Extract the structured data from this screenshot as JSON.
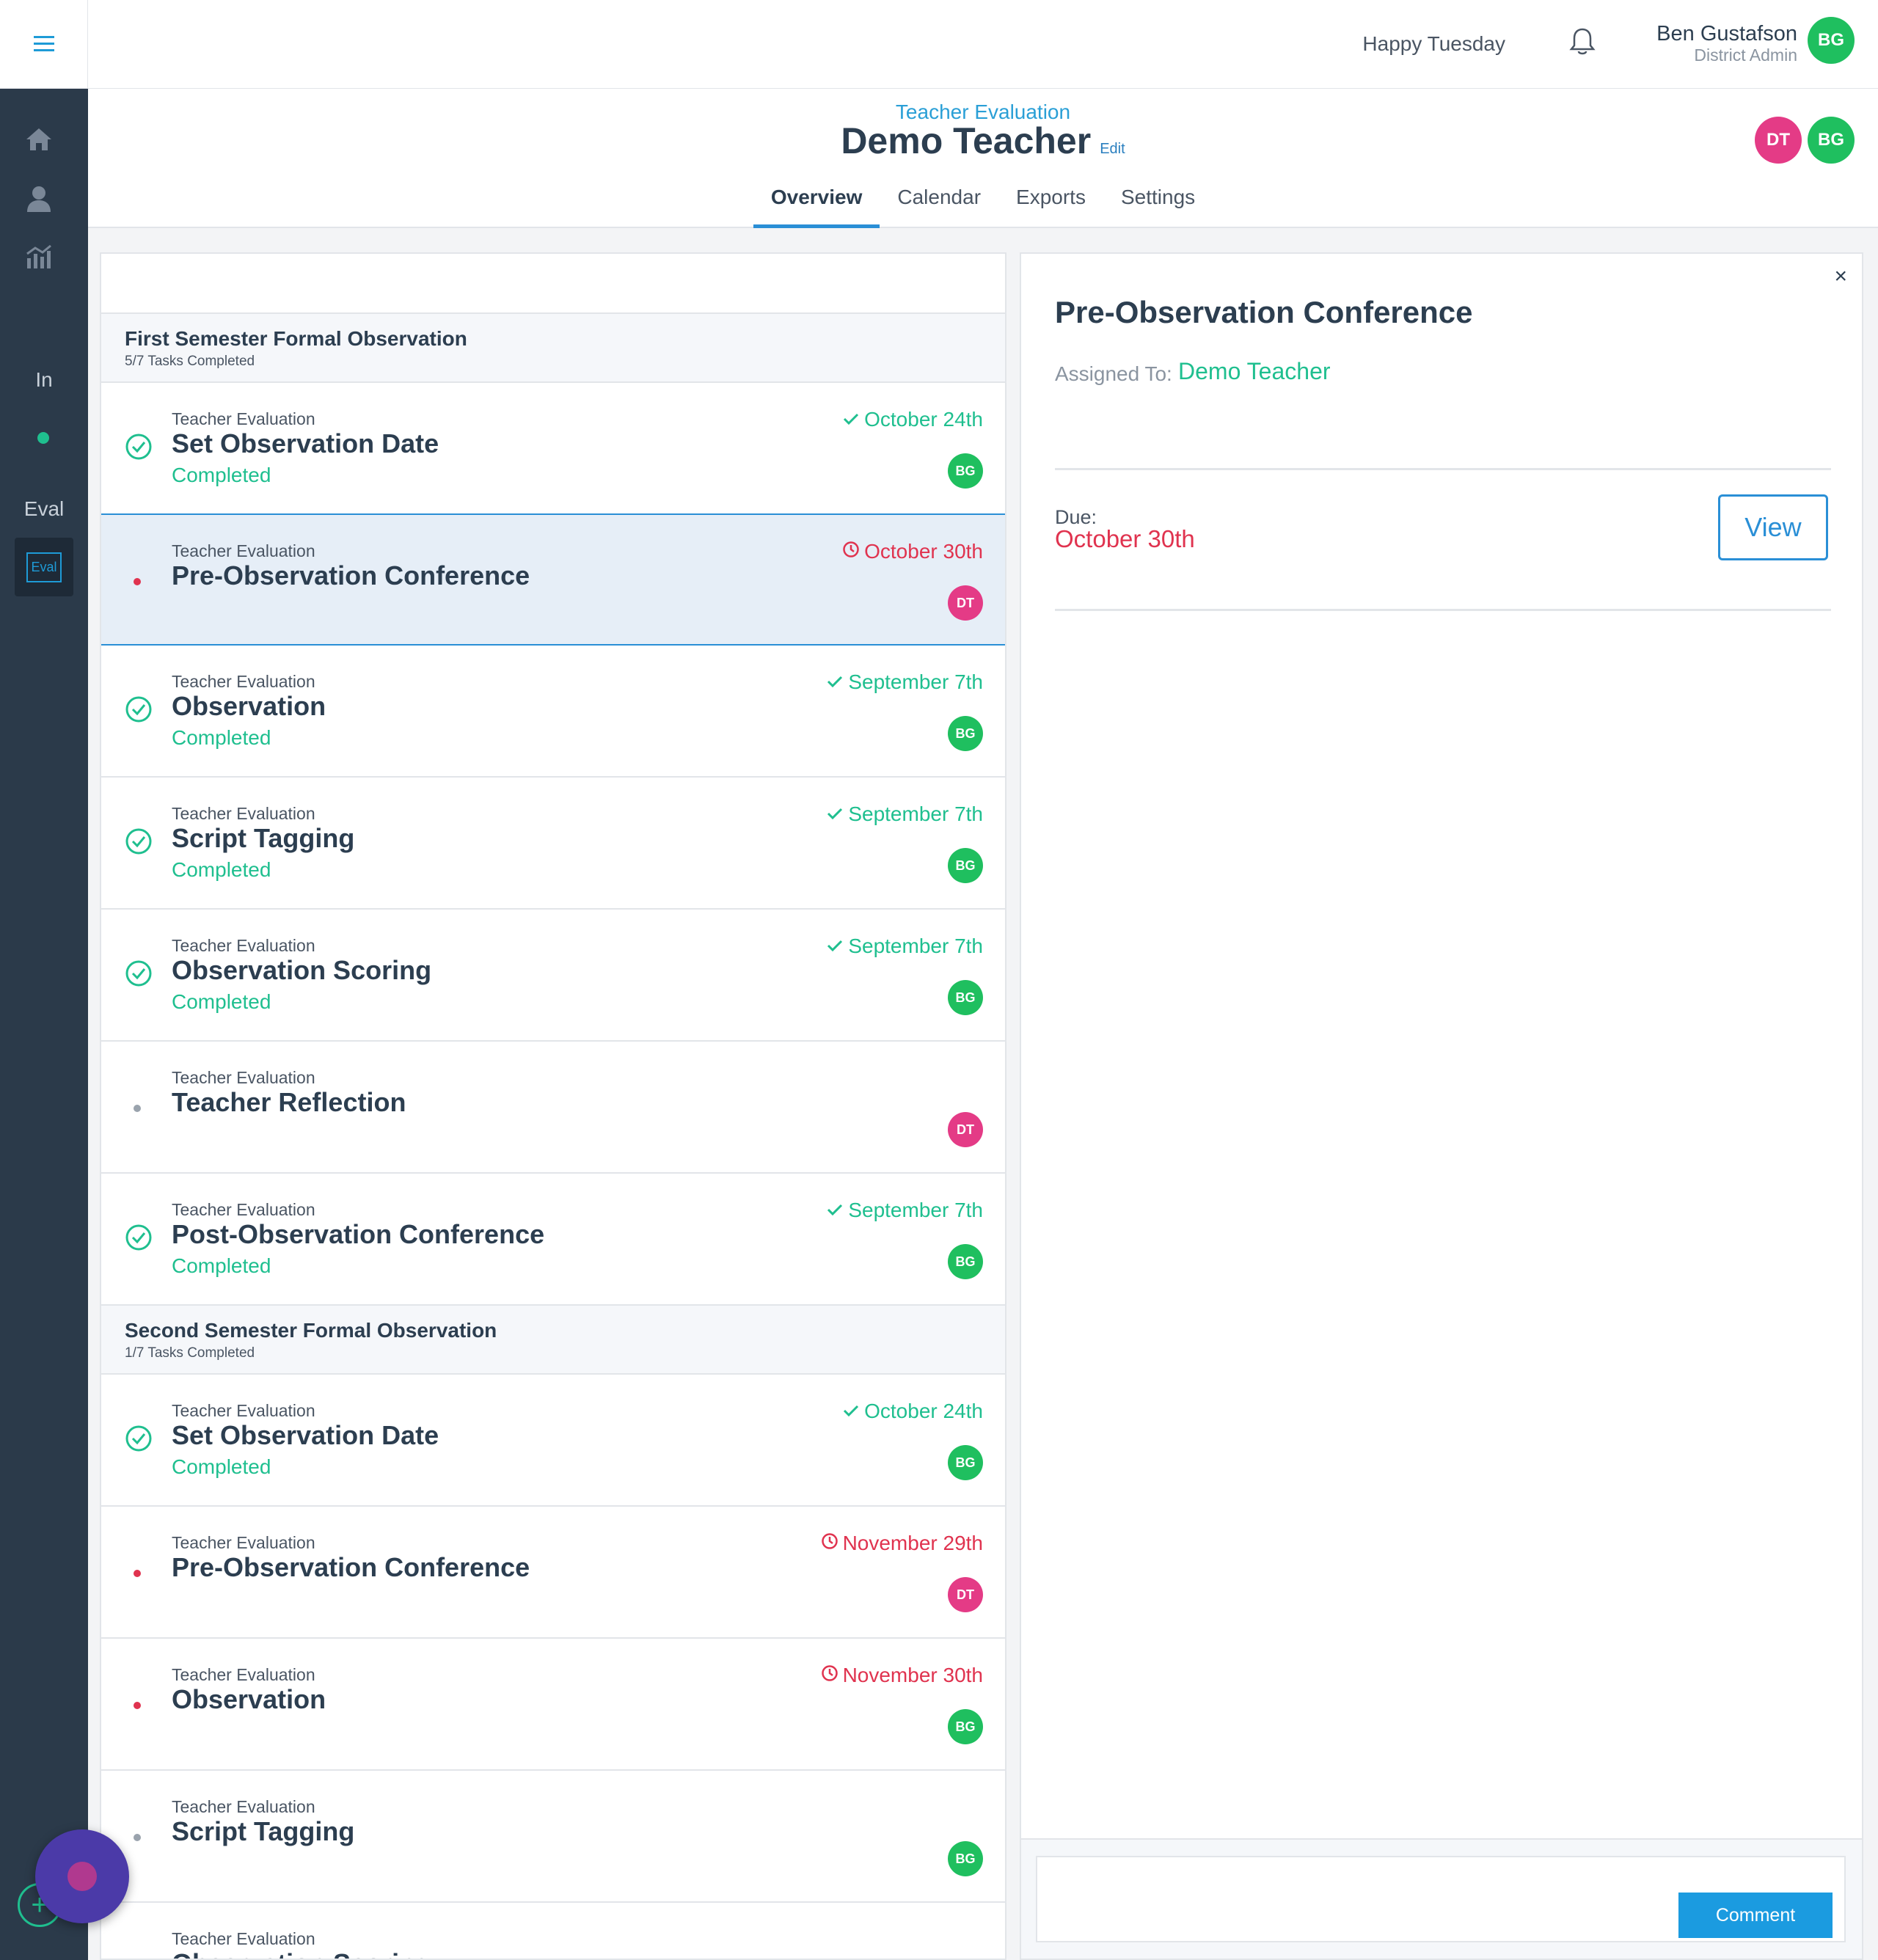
{
  "header": {
    "greeting": "Happy Tuesday",
    "user_name": "Ben Gustafson",
    "user_role": "District Admin",
    "user_initials": "BG"
  },
  "sidebar": {
    "text_in": "In",
    "text_eval": "Eval",
    "eval_badge": "Eval",
    "plus": "+"
  },
  "subheader": {
    "eyebrow": "Teacher Evaluation",
    "title": "Demo Teacher",
    "edit": "Edit",
    "avatars": [
      "DT",
      "BG"
    ],
    "tabs": [
      "Overview",
      "Calendar",
      "Exports",
      "Settings"
    ],
    "active_tab": "Overview"
  },
  "sections": [
    {
      "title": "First Semester Formal Observation",
      "progress": "5/7 Tasks Completed",
      "tasks": [
        {
          "eyebrow": "Teacher Evaluation",
          "title": "Set Observation Date",
          "status": "Completed",
          "date": "October 24th",
          "date_state": "done",
          "assignee": "BG"
        },
        {
          "eyebrow": "Teacher Evaluation",
          "title": "Pre-Observation Conference",
          "status": "",
          "date": "October 30th",
          "date_state": "due",
          "assignee": "DT"
        },
        {
          "eyebrow": "Teacher Evaluation",
          "title": "Observation",
          "status": "Completed",
          "date": "September 7th",
          "date_state": "done",
          "assignee": "BG"
        },
        {
          "eyebrow": "Teacher Evaluation",
          "title": "Script Tagging",
          "status": "Completed",
          "date": "September 7th",
          "date_state": "done",
          "assignee": "BG"
        },
        {
          "eyebrow": "Teacher Evaluation",
          "title": "Observation Scoring",
          "status": "Completed",
          "date": "September 7th",
          "date_state": "done",
          "assignee": "BG"
        },
        {
          "eyebrow": "Teacher Evaluation",
          "title": "Teacher Reflection",
          "status": "",
          "date": "",
          "date_state": "none",
          "assignee": "DT"
        },
        {
          "eyebrow": "Teacher Evaluation",
          "title": "Post-Observation Conference",
          "status": "Completed",
          "date": "September 7th",
          "date_state": "done",
          "assignee": "BG"
        }
      ]
    },
    {
      "title": "Second Semester Formal Observation",
      "progress": "1/7 Tasks Completed",
      "tasks": [
        {
          "eyebrow": "Teacher Evaluation",
          "title": "Set Observation Date",
          "status": "Completed",
          "date": "October 24th",
          "date_state": "done",
          "assignee": "BG"
        },
        {
          "eyebrow": "Teacher Evaluation",
          "title": "Pre-Observation Conference",
          "status": "",
          "date": "November 29th",
          "date_state": "due",
          "assignee": "DT"
        },
        {
          "eyebrow": "Teacher Evaluation",
          "title": "Observation",
          "status": "",
          "date": "November 30th",
          "date_state": "due",
          "assignee": "BG"
        },
        {
          "eyebrow": "Teacher Evaluation",
          "title": "Script Tagging",
          "status": "",
          "date": "",
          "date_state": "none",
          "assignee": "BG"
        },
        {
          "eyebrow": "Teacher Evaluation",
          "title": "Observation Scoring",
          "status": "",
          "date": "",
          "date_state": "none",
          "assignee": ""
        }
      ]
    }
  ],
  "detail": {
    "title": "Pre-Observation Conference",
    "assigned_label": "Assigned To:",
    "assigned_value": "Demo Teacher",
    "due_label": "Due:",
    "due_value": "October 30th",
    "view_label": "View",
    "comment_label": "Comment",
    "close": "×"
  },
  "colors": {
    "accent_blue": "#2a8fd6",
    "success_green": "#1fbf8f",
    "danger_red": "#e0334f",
    "avatar_bg_green": "#1fbf5f",
    "avatar_bg_pink": "#e43b86",
    "sidebar": "#2b3a4a"
  }
}
